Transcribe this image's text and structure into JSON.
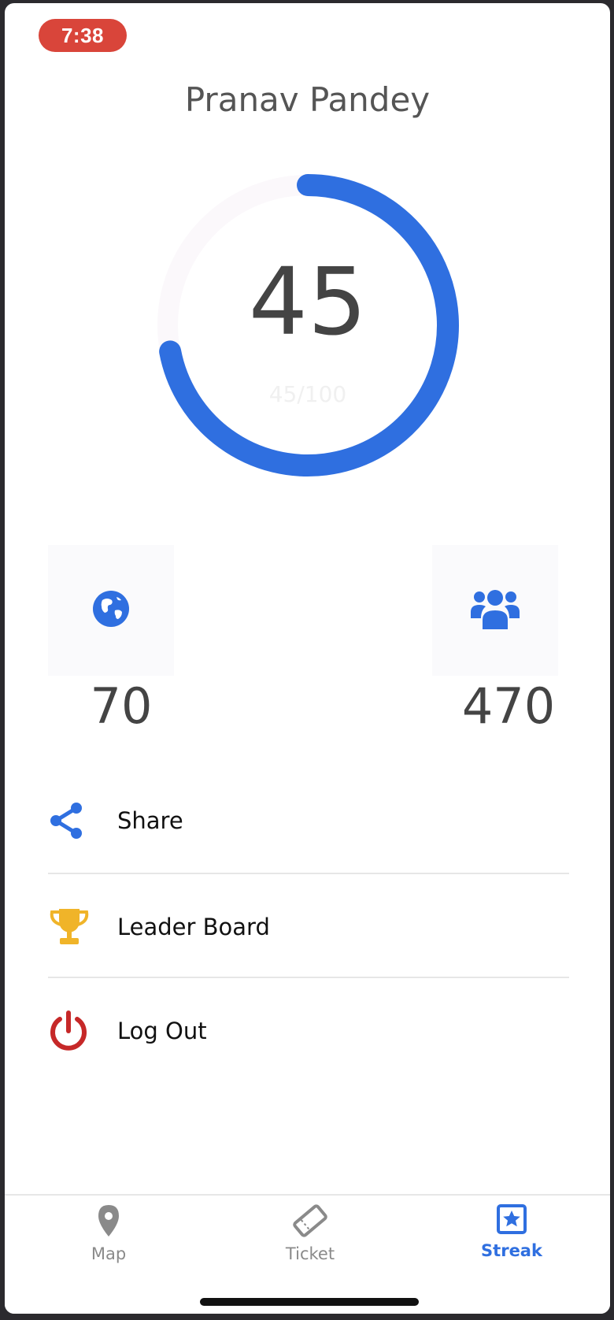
{
  "status_bar": {
    "time": "7:38"
  },
  "profile": {
    "name": "Pranav Pandey"
  },
  "progress": {
    "value_label": "45",
    "sub_label": "45/100",
    "fraction": 0.45,
    "ring_color": "#2f6fe0"
  },
  "stats": [
    {
      "icon": "globe-icon",
      "value": "70"
    },
    {
      "icon": "group-icon",
      "value": "470"
    }
  ],
  "menu": [
    {
      "label": "Share",
      "icon": "share-icon",
      "icon_color": "#2f6fe0"
    },
    {
      "label": "Leader Board",
      "icon": "trophy-icon",
      "icon_color": "#f0b429"
    },
    {
      "label": "Log Out",
      "icon": "power-icon",
      "icon_color": "#c62828"
    }
  ],
  "tabs": [
    {
      "label": "Map",
      "icon": "map-pin-icon",
      "active": false
    },
    {
      "label": "Ticket",
      "icon": "ticket-icon",
      "active": false
    },
    {
      "label": "Streak",
      "icon": "star-square-icon",
      "active": true
    }
  ],
  "colors": {
    "accent": "#2f6fe0",
    "status_pill": "#d9453a"
  }
}
